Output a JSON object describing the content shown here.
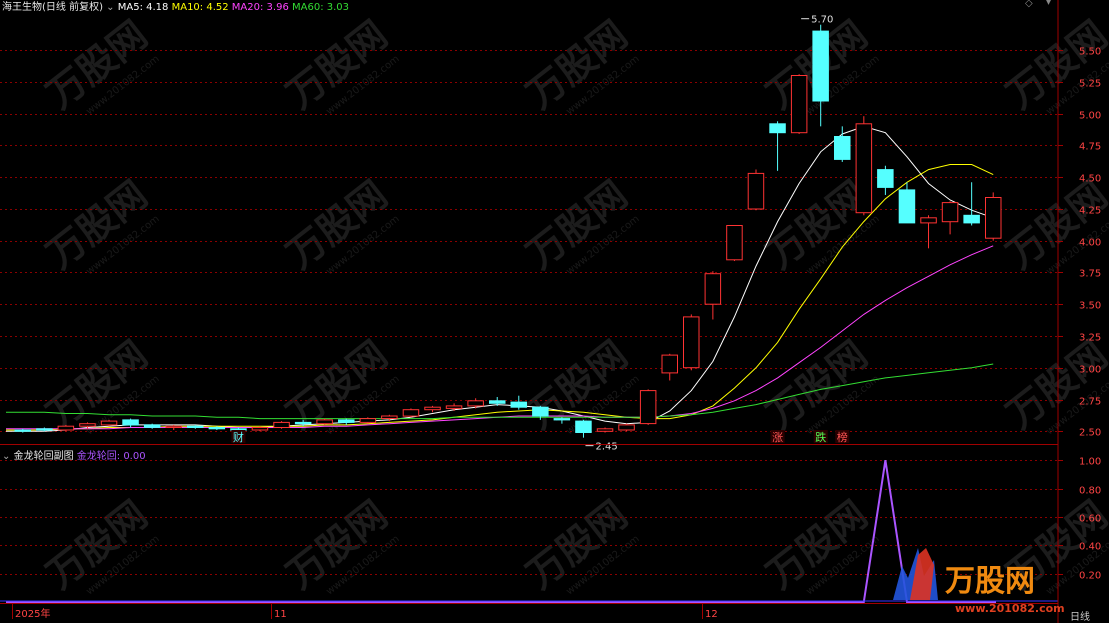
{
  "header": {
    "symbol": "海王生物(日线 前复权)",
    "ma": [
      {
        "label": "MA5: 4.18",
        "color": "#ffffff"
      },
      {
        "label": "MA10: 4.52",
        "color": "#ffff00"
      },
      {
        "label": "MA20: 3.96",
        "color": "#ff44ff"
      },
      {
        "label": "MA60: 3.03",
        "color": "#33dd33"
      }
    ]
  },
  "subchart": {
    "title": "金龙轮回副图",
    "indicator": "金龙轮回: 0.00",
    "indicator_color": "#aa55ff"
  },
  "watermark": {
    "brand": "万股网",
    "url": "www.201082.com"
  },
  "footer": {
    "period": "日线"
  },
  "colors": {
    "up": "#ff3333",
    "down": "#55ffff",
    "grid": "#8b0000"
  },
  "chart_data": [
    {
      "type": "candlestick",
      "ylim": [
        2.4,
        5.8
      ],
      "y_ticks": [
        "2.50",
        "2.75",
        "3.00",
        "3.25",
        "3.50",
        "3.75",
        "4.00",
        "4.25",
        "4.50",
        "4.75",
        "5.00",
        "5.25",
        "5.50"
      ],
      "x_ticks": [
        {
          "label": "2025年",
          "index": 0
        },
        {
          "label": "11",
          "index": 12
        },
        {
          "label": "12",
          "index": 32
        }
      ],
      "annotations": [
        {
          "text": "5.70",
          "index": 36,
          "value": 5.7,
          "kind": "high"
        },
        {
          "text": "2.45",
          "index": 26,
          "value": 2.45,
          "kind": "low"
        }
      ],
      "event_tags": [
        {
          "text": "财",
          "index": 10,
          "color": "#55ffff"
        },
        {
          "text": "涨",
          "index": 35,
          "color": "#ff5555"
        },
        {
          "text": "跌",
          "index": 37,
          "color": "#55ff55"
        },
        {
          "text": "榜",
          "index": 38,
          "color": "#ff5555"
        }
      ],
      "candles": [
        {
          "o": 2.51,
          "h": 2.52,
          "l": 2.49,
          "c": 2.5
        },
        {
          "o": 2.52,
          "h": 2.53,
          "l": 2.5,
          "c": 2.51
        },
        {
          "o": 2.51,
          "h": 2.55,
          "l": 2.5,
          "c": 2.54
        },
        {
          "o": 2.54,
          "h": 2.57,
          "l": 2.52,
          "c": 2.56
        },
        {
          "o": 2.55,
          "h": 2.59,
          "l": 2.54,
          "c": 2.58
        },
        {
          "o": 2.59,
          "h": 2.6,
          "l": 2.53,
          "c": 2.55
        },
        {
          "o": 2.55,
          "h": 2.56,
          "l": 2.52,
          "c": 2.53
        },
        {
          "o": 2.53,
          "h": 2.55,
          "l": 2.51,
          "c": 2.54
        },
        {
          "o": 2.54,
          "h": 2.55,
          "l": 2.52,
          "c": 2.53
        },
        {
          "o": 2.53,
          "h": 2.54,
          "l": 2.51,
          "c": 2.52
        },
        {
          "o": 2.52,
          "h": 2.53,
          "l": 2.5,
          "c": 2.51
        },
        {
          "o": 2.51,
          "h": 2.54,
          "l": 2.5,
          "c": 2.53
        },
        {
          "o": 2.53,
          "h": 2.58,
          "l": 2.52,
          "c": 2.57
        },
        {
          "o": 2.57,
          "h": 2.59,
          "l": 2.54,
          "c": 2.56
        },
        {
          "o": 2.56,
          "h": 2.6,
          "l": 2.55,
          "c": 2.59
        },
        {
          "o": 2.59,
          "h": 2.6,
          "l": 2.55,
          "c": 2.57
        },
        {
          "o": 2.57,
          "h": 2.61,
          "l": 2.56,
          "c": 2.6
        },
        {
          "o": 2.6,
          "h": 2.63,
          "l": 2.58,
          "c": 2.62
        },
        {
          "o": 2.62,
          "h": 2.68,
          "l": 2.61,
          "c": 2.67
        },
        {
          "o": 2.67,
          "h": 2.7,
          "l": 2.65,
          "c": 2.69
        },
        {
          "o": 2.68,
          "h": 2.72,
          "l": 2.66,
          "c": 2.7
        },
        {
          "o": 2.7,
          "h": 2.76,
          "l": 2.68,
          "c": 2.74
        },
        {
          "o": 2.74,
          "h": 2.77,
          "l": 2.7,
          "c": 2.72
        },
        {
          "o": 2.73,
          "h": 2.78,
          "l": 2.67,
          "c": 2.69
        },
        {
          "o": 2.69,
          "h": 2.7,
          "l": 2.59,
          "c": 2.62
        },
        {
          "o": 2.6,
          "h": 2.61,
          "l": 2.56,
          "c": 2.59
        },
        {
          "o": 2.58,
          "h": 2.59,
          "l": 2.45,
          "c": 2.49
        },
        {
          "o": 2.5,
          "h": 2.53,
          "l": 2.49,
          "c": 2.52
        },
        {
          "o": 2.51,
          "h": 2.56,
          "l": 2.5,
          "c": 2.55
        },
        {
          "o": 2.56,
          "h": 2.83,
          "l": 2.55,
          "c": 2.82
        },
        {
          "o": 2.96,
          "h": 3.11,
          "l": 2.9,
          "c": 3.1
        },
        {
          "o": 3.0,
          "h": 3.42,
          "l": 2.98,
          "c": 3.4
        },
        {
          "o": 3.5,
          "h": 3.76,
          "l": 3.38,
          "c": 3.74
        },
        {
          "o": 3.85,
          "h": 4.12,
          "l": 3.84,
          "c": 4.12
        },
        {
          "o": 4.25,
          "h": 4.56,
          "l": 4.24,
          "c": 4.53
        },
        {
          "o": 4.92,
          "h": 4.94,
          "l": 4.55,
          "c": 4.85
        },
        {
          "o": 4.85,
          "h": 5.31,
          "l": 4.84,
          "c": 5.3
        },
        {
          "o": 5.65,
          "h": 5.7,
          "l": 4.9,
          "c": 5.1
        },
        {
          "o": 4.82,
          "h": 4.9,
          "l": 4.62,
          "c": 4.64
        },
        {
          "o": 4.22,
          "h": 4.98,
          "l": 4.2,
          "c": 4.92
        },
        {
          "o": 4.56,
          "h": 4.59,
          "l": 4.36,
          "c": 4.42
        },
        {
          "o": 4.4,
          "h": 4.46,
          "l": 4.14,
          "c": 4.14
        },
        {
          "o": 4.14,
          "h": 4.2,
          "l": 3.94,
          "c": 4.18
        },
        {
          "o": 4.15,
          "h": 4.31,
          "l": 4.05,
          "c": 4.3
        },
        {
          "o": 4.2,
          "h": 4.46,
          "l": 4.12,
          "c": 4.14
        },
        {
          "o": 4.02,
          "h": 4.38,
          "l": 4.0,
          "c": 4.34
        }
      ],
      "series": [
        {
          "name": "MA5",
          "color": "#ffffff",
          "values": [
            2.5,
            2.5,
            2.51,
            2.53,
            2.54,
            2.55,
            2.55,
            2.55,
            2.55,
            2.54,
            2.53,
            2.53,
            2.54,
            2.55,
            2.56,
            2.57,
            2.58,
            2.59,
            2.61,
            2.64,
            2.67,
            2.69,
            2.71,
            2.7,
            2.69,
            2.66,
            2.62,
            2.58,
            2.56,
            2.57,
            2.66,
            2.82,
            3.05,
            3.4,
            3.8,
            4.15,
            4.45,
            4.7,
            4.84,
            4.9,
            4.85,
            4.66,
            4.45,
            4.32,
            4.24,
            4.18
          ]
        },
        {
          "name": "MA10",
          "color": "#ffff00",
          "values": [
            2.51,
            2.51,
            2.52,
            2.52,
            2.53,
            2.53,
            2.53,
            2.54,
            2.54,
            2.54,
            2.54,
            2.54,
            2.54,
            2.54,
            2.55,
            2.55,
            2.56,
            2.57,
            2.58,
            2.59,
            2.61,
            2.63,
            2.65,
            2.66,
            2.67,
            2.66,
            2.65,
            2.63,
            2.61,
            2.6,
            2.6,
            2.63,
            2.7,
            2.84,
            3.0,
            3.2,
            3.46,
            3.7,
            3.95,
            4.15,
            4.33,
            4.46,
            4.56,
            4.6,
            4.6,
            4.52
          ]
        },
        {
          "name": "MA20",
          "color": "#ff44ff",
          "values": [
            2.52,
            2.52,
            2.52,
            2.52,
            2.52,
            2.53,
            2.53,
            2.53,
            2.53,
            2.53,
            2.53,
            2.53,
            2.53,
            2.53,
            2.54,
            2.54,
            2.55,
            2.56,
            2.57,
            2.58,
            2.59,
            2.6,
            2.61,
            2.62,
            2.62,
            2.62,
            2.62,
            2.61,
            2.61,
            2.61,
            2.62,
            2.64,
            2.68,
            2.74,
            2.82,
            2.92,
            3.04,
            3.16,
            3.29,
            3.42,
            3.53,
            3.63,
            3.72,
            3.81,
            3.89,
            3.96
          ]
        },
        {
          "name": "MA60",
          "color": "#33dd33",
          "values": [
            2.65,
            2.65,
            2.64,
            2.64,
            2.63,
            2.63,
            2.62,
            2.62,
            2.62,
            2.61,
            2.61,
            2.6,
            2.6,
            2.6,
            2.6,
            2.6,
            2.6,
            2.6,
            2.6,
            2.6,
            2.61,
            2.61,
            2.61,
            2.61,
            2.61,
            2.61,
            2.61,
            2.61,
            2.61,
            2.61,
            2.62,
            2.63,
            2.65,
            2.68,
            2.71,
            2.75,
            2.79,
            2.83,
            2.86,
            2.89,
            2.92,
            2.94,
            2.96,
            2.98,
            3.0,
            3.03
          ]
        }
      ]
    },
    {
      "type": "line",
      "ylim": [
        0,
        1.1
      ],
      "y_ticks": [
        "0.20",
        "0.40",
        "0.60",
        "0.80",
        "1.00"
      ],
      "series": [
        {
          "name": "金龙轮回",
          "color": "#aa55ff",
          "values": [
            0,
            0,
            0,
            0,
            0,
            0,
            0,
            0,
            0,
            0,
            0,
            0,
            0,
            0,
            0,
            0,
            0,
            0,
            0,
            0,
            0,
            0,
            0,
            0,
            0,
            0,
            0,
            0,
            0,
            0,
            0,
            0,
            0,
            0,
            0,
            0,
            0,
            0,
            0,
            0,
            1,
            0,
            0,
            0,
            0,
            0
          ]
        }
      ]
    }
  ]
}
